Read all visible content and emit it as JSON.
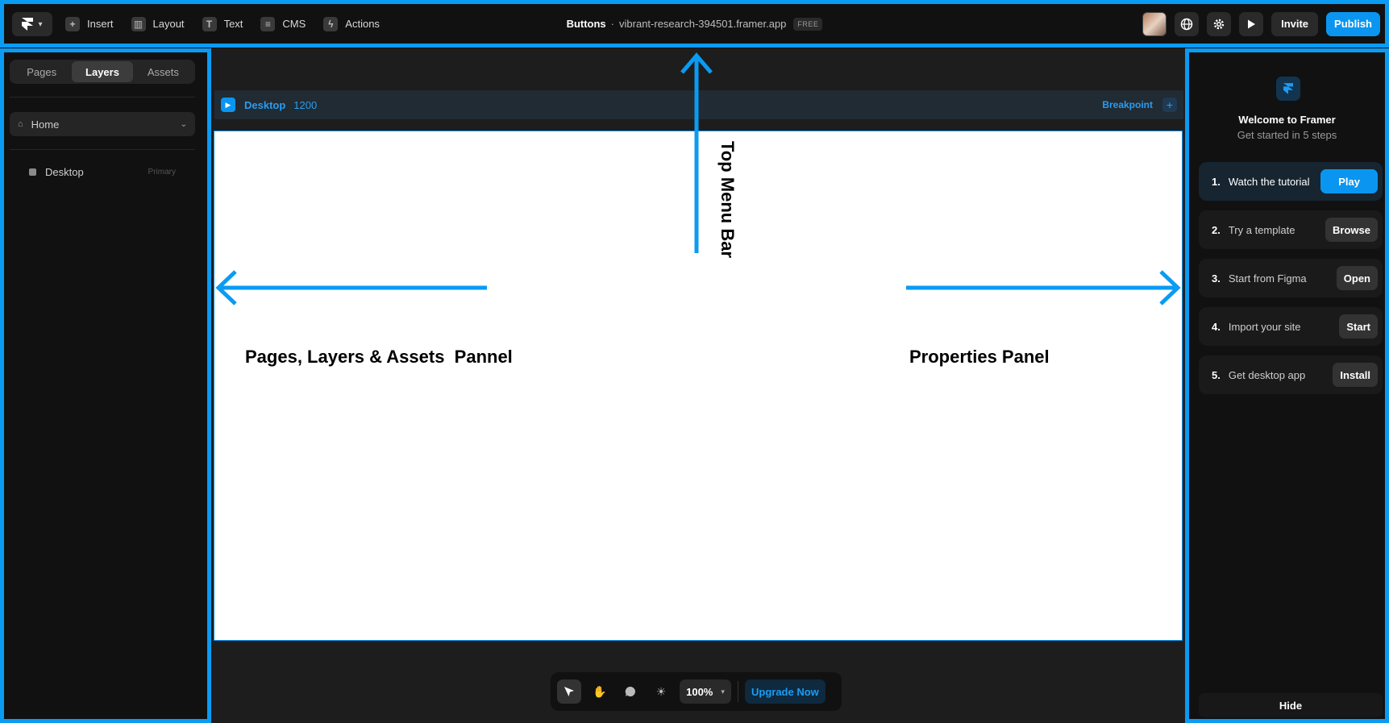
{
  "topbar": {
    "menu": [
      {
        "label": "Insert",
        "icon": "plus-square-icon"
      },
      {
        "label": "Layout",
        "icon": "layout-icon"
      },
      {
        "label": "Text",
        "icon": "text-icon"
      },
      {
        "label": "CMS",
        "icon": "database-icon"
      },
      {
        "label": "Actions",
        "icon": "bolt-icon"
      }
    ],
    "project_name": "Buttons",
    "separator": "·",
    "domain": "vibrant-research-394501.framer.app",
    "plan_badge": "FREE",
    "invite_label": "Invite",
    "publish_label": "Publish"
  },
  "left_panel": {
    "tabs": [
      {
        "label": "Pages",
        "active": false
      },
      {
        "label": "Layers",
        "active": true
      },
      {
        "label": "Assets",
        "active": false
      }
    ],
    "page_select": "Home",
    "layers": [
      {
        "name": "Desktop",
        "tag": "Primary"
      }
    ]
  },
  "canvas": {
    "breakpoint_name": "Desktop",
    "breakpoint_width": "1200",
    "breakpoint_label": "Breakpoint",
    "annotations": {
      "top": "Top Menu Bar",
      "left": "Pages, Layers & Assets  Pannel",
      "right": "Properties Panel"
    },
    "toolbar": {
      "zoom": "100%",
      "upgrade_label": "Upgrade Now"
    }
  },
  "right_panel": {
    "title": "Welcome to Framer",
    "subtitle": "Get started in 5 steps",
    "steps": [
      {
        "num": "1.",
        "label": "Watch the tutorial",
        "action": "Play"
      },
      {
        "num": "2.",
        "label": "Try a template",
        "action": "Browse"
      },
      {
        "num": "3.",
        "label": "Start from Figma",
        "action": "Open"
      },
      {
        "num": "4.",
        "label": "Import your site",
        "action": "Start"
      },
      {
        "num": "5.",
        "label": "Get desktop app",
        "action": "Install"
      }
    ],
    "hide_label": "Hide"
  },
  "colors": {
    "accent": "#0a96f0",
    "annotation": "#0a9bf3",
    "background": "#111111",
    "canvas": "#1d1d1d"
  }
}
